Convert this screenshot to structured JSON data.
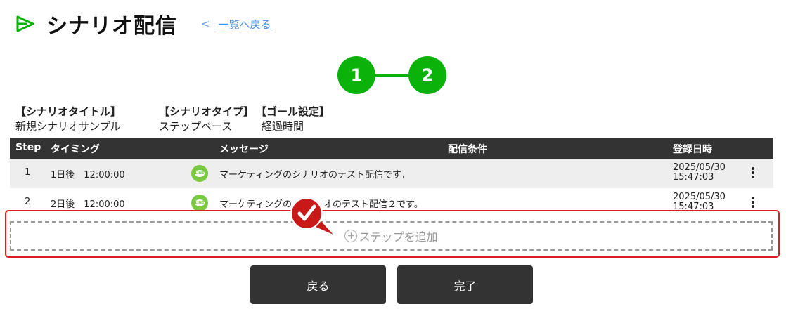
{
  "header": {
    "title": "シナリオ配信",
    "back_chevron": "<",
    "back_link": "一覧へ戻る",
    "icon": "play-outline-icon"
  },
  "stepper": {
    "steps": [
      "1",
      "2"
    ],
    "active_color": "#0ab20a"
  },
  "scenario_info": {
    "title_label": "【シナリオタイトル】",
    "title_value": "新規シナリオサンプル",
    "type_label": "【シナリオタイプ】",
    "type_value": "ステップベース",
    "goal_label": "【ゴール設定】",
    "goal_value": "経過時間"
  },
  "table": {
    "columns": [
      "Step",
      "タイミング",
      "メッセージ",
      "配信条件",
      "登録日時"
    ],
    "rows": [
      {
        "step": "1",
        "timing": "1日後　12:00:00",
        "channel_icon": "line-icon",
        "message": "マーケティングのシナリオのテスト配信です。",
        "date": "2025/05/30",
        "time": "15:47:03"
      },
      {
        "step": "2",
        "timing": "2日後　12:00:00",
        "channel_icon": "line-icon",
        "message_before": "マーケティングの",
        "message_after": "オのテスト配信２です。",
        "date": "2025/05/30",
        "time": "15:47:03"
      }
    ]
  },
  "add_step": {
    "label": "ステップを追加",
    "icon": "plus-circle-icon"
  },
  "buttons": {
    "back": "戻る",
    "finish": "完了"
  },
  "colors": {
    "accent_green": "#0ab20a",
    "highlight_red": "#d81e1e",
    "header_dark": "#333333",
    "line_green": "#7ac943"
  }
}
